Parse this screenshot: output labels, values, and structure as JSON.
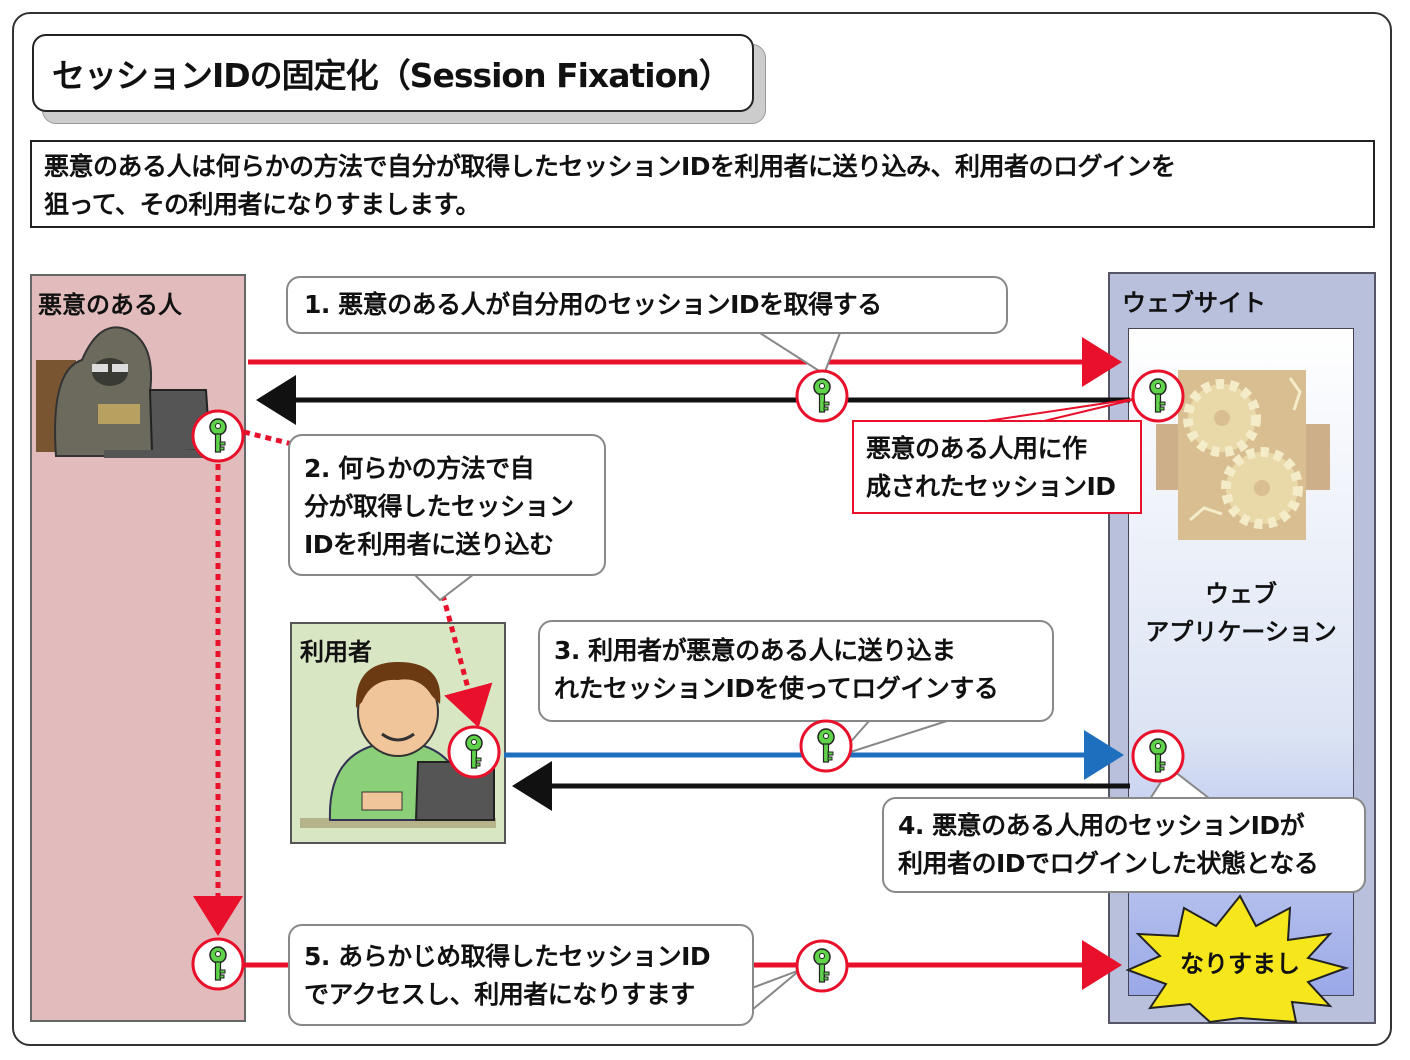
{
  "title": "セッションIDの固定化（Session Fixation）",
  "description": {
    "line1": "悪意のある人は何らかの方法で自分が取得したセッションIDを利用者に送り込み、利用者のログインを",
    "line2": "狙って、その利用者になりすまします。"
  },
  "actors": {
    "attacker": "悪意のある人",
    "user": "利用者",
    "website": "ウェブサイト",
    "webapp_line1": "ウェブ",
    "webapp_line2": "アプリケーション"
  },
  "steps": {
    "step1": "1. 悪意のある人が自分用のセッションIDを取得する",
    "step2_line1": "2. 何らかの方法で自",
    "step2_line2": "分が取得したセッション",
    "step2_line3": "IDを利用者に送り込む",
    "step3_line1": "3. 利用者が悪意のある人に送り込ま",
    "step3_line2": "れたセッションIDを使ってログインする",
    "step4_line1": "4. 悪意のある人用のセッションIDが",
    "step4_line2": "利用者のIDでログインした状態となる",
    "step5_line1": "5. あらかじめ取得したセッションID",
    "step5_line2": "でアクセスし、利用者になりすます"
  },
  "notes": {
    "session_created_line1": "悪意のある人用に作",
    "session_created_line2": "成されたセッションID",
    "impersonation": "なりすまし"
  },
  "colors": {
    "attacker_arrow": "#e8102a",
    "user_arrow": "#1f6fbf",
    "response_arrow": "#111111",
    "key": "#5fd34a"
  },
  "icons": [
    "key-icon",
    "gear-icon",
    "hooded-attacker-icon",
    "user-at-laptop-icon",
    "explosion-burst-icon"
  ]
}
